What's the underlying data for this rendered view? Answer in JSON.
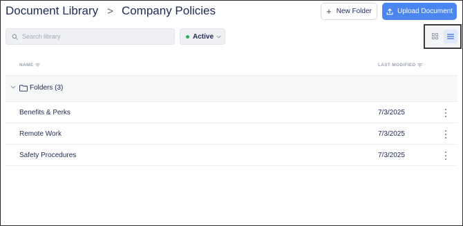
{
  "breadcrumb": {
    "root": "Document Library",
    "separator": ">",
    "current": "Company Policies"
  },
  "actions": {
    "new_folder_label": "New Folder",
    "upload_label": "Upload Document"
  },
  "search": {
    "placeholder": "Search library",
    "value": ""
  },
  "status_filter": {
    "selected": "Active",
    "indicator_color": "#22b45a"
  },
  "view_toggle": {
    "options": [
      "grid",
      "list"
    ],
    "active": "list"
  },
  "table": {
    "columns": {
      "name": "NAME",
      "modified": "LAST MODIFIED"
    },
    "group": {
      "label": "Folders (3)"
    },
    "rows": [
      {
        "name": "Benefits & Perks",
        "modified": "7/3/2025"
      },
      {
        "name": "Remote Work",
        "modified": "7/3/2025"
      },
      {
        "name": "Safety Procedures",
        "modified": "7/3/2025"
      }
    ]
  },
  "colors": {
    "accent": "#4a86ee",
    "text": "#1c2752",
    "active_dot": "#22b45a"
  }
}
